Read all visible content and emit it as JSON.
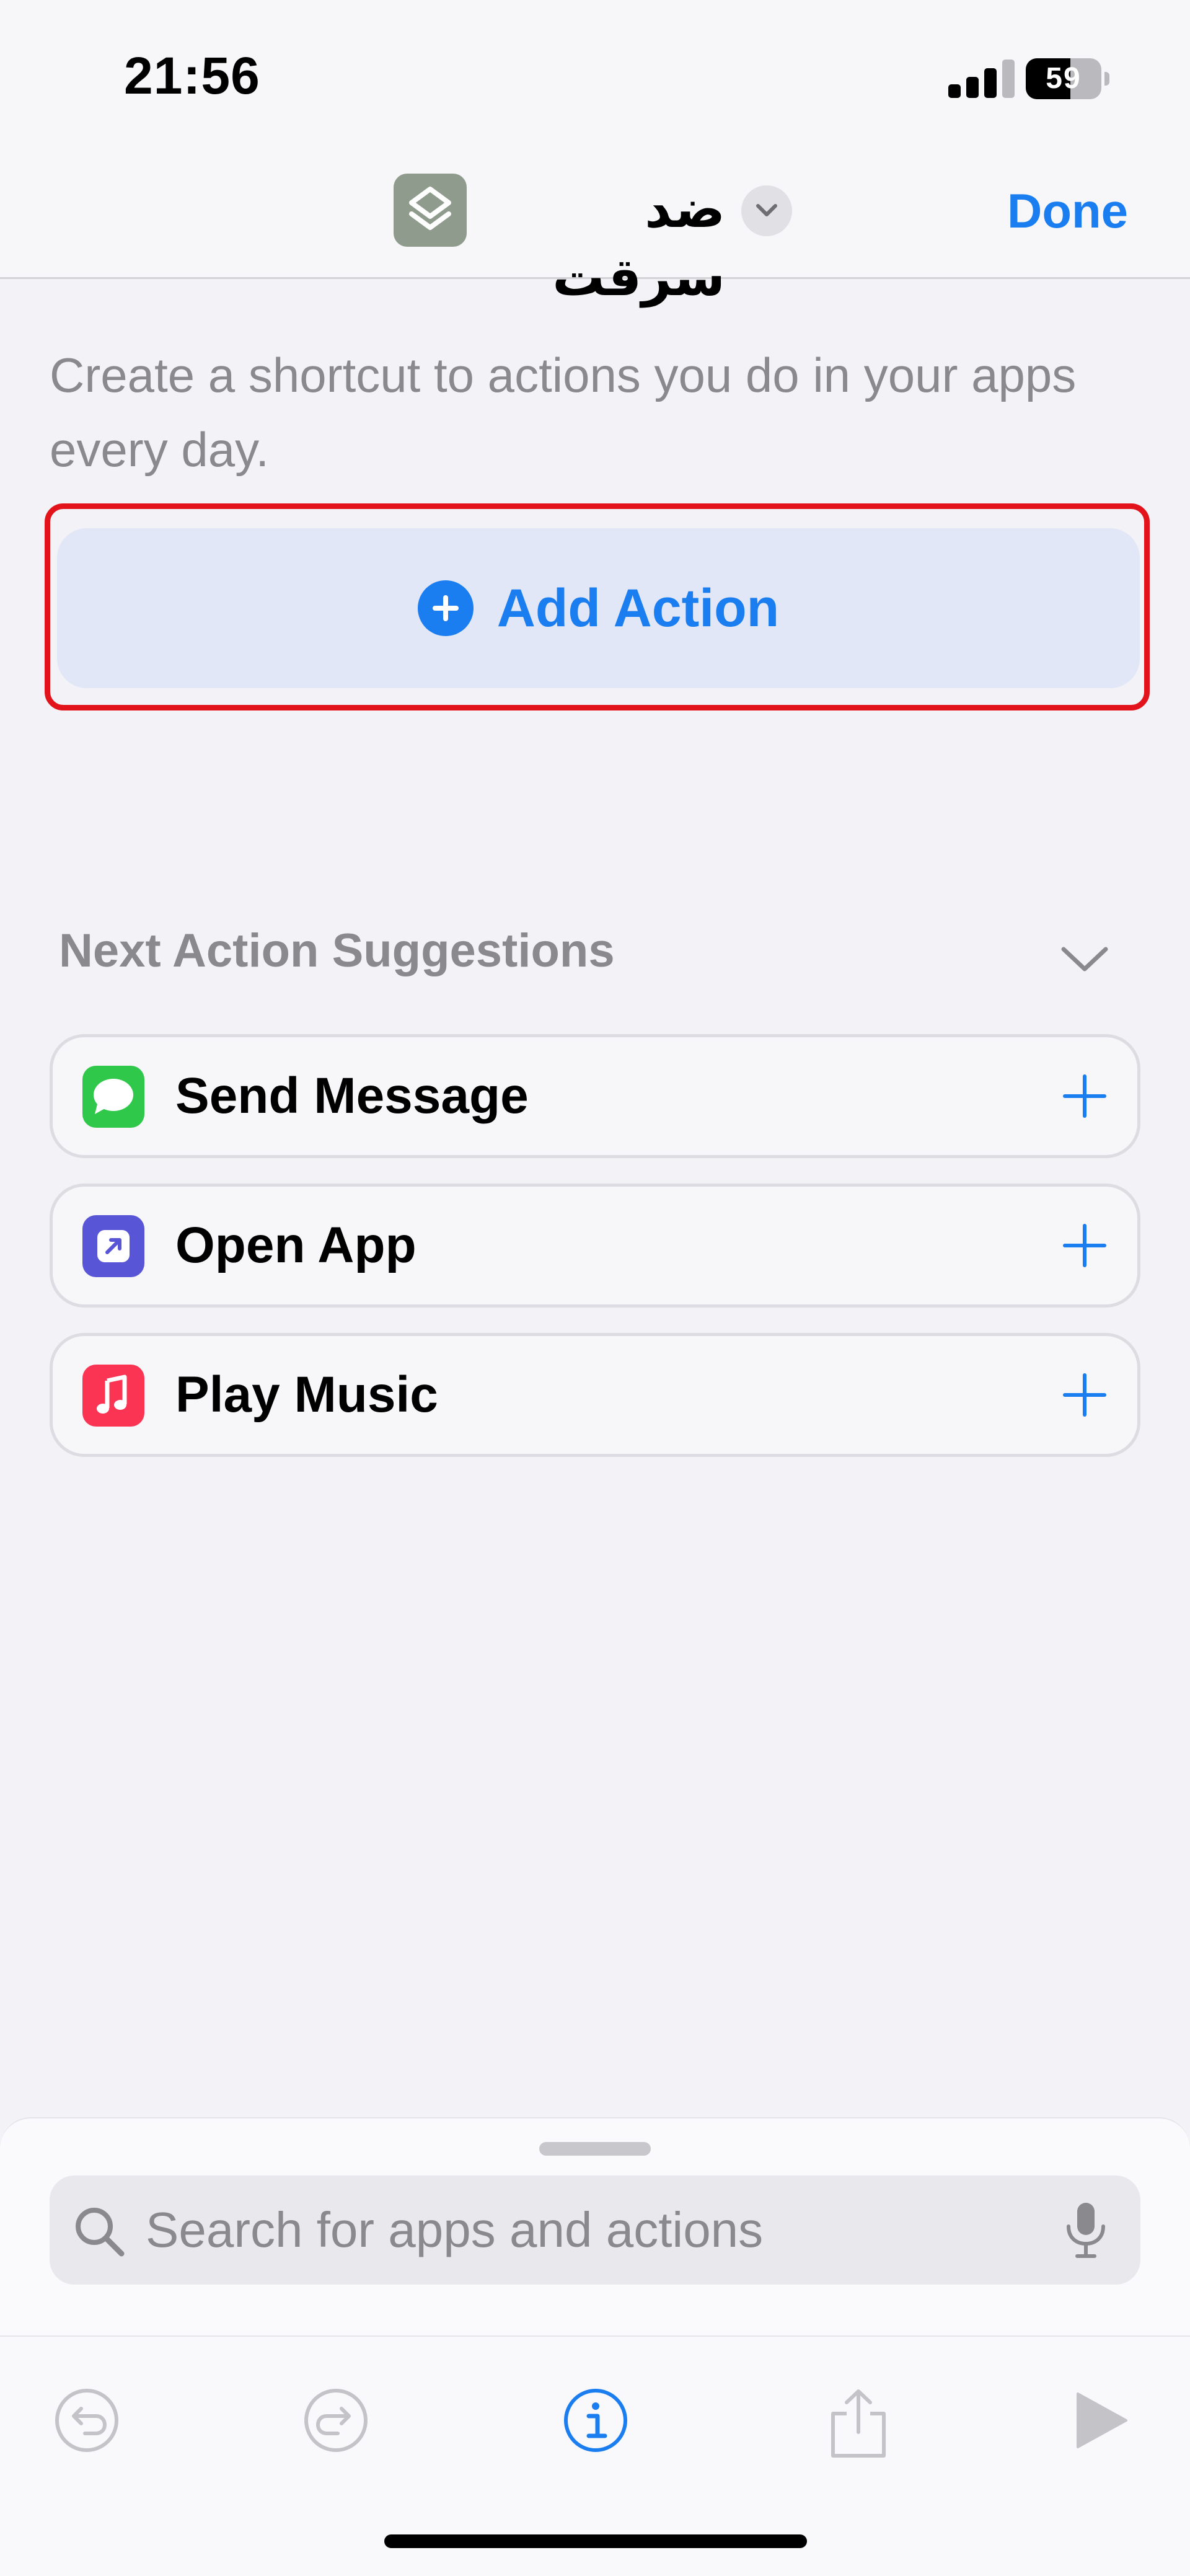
{
  "status_bar": {
    "time": "21:56",
    "battery_level": "59",
    "battery_fraction": 0.59
  },
  "nav": {
    "shortcut_title": "ضد سرقت",
    "done_label": "Done",
    "app_icon": "layers-icon",
    "app_icon_color": "#8f9c8d"
  },
  "main": {
    "description": "Create a shortcut to actions you do in your apps every day.",
    "add_action_label": "Add Action",
    "highlight_color": "#e3131c",
    "accent_color": "#1a7df0"
  },
  "suggestions": {
    "header": "Next Action Suggestions",
    "items": [
      {
        "label": "Send Message",
        "icon": "messages-icon",
        "icon_color": "#30c84a"
      },
      {
        "label": "Open App",
        "icon": "open-app-icon",
        "icon_color": "#5856d6"
      },
      {
        "label": "Play Music",
        "icon": "music-icon",
        "icon_color": "#fa3452"
      }
    ]
  },
  "search": {
    "placeholder": "Search for apps and actions"
  },
  "toolbar": {
    "items": [
      "undo-icon",
      "redo-icon",
      "info-icon",
      "share-icon",
      "play-icon"
    ]
  }
}
